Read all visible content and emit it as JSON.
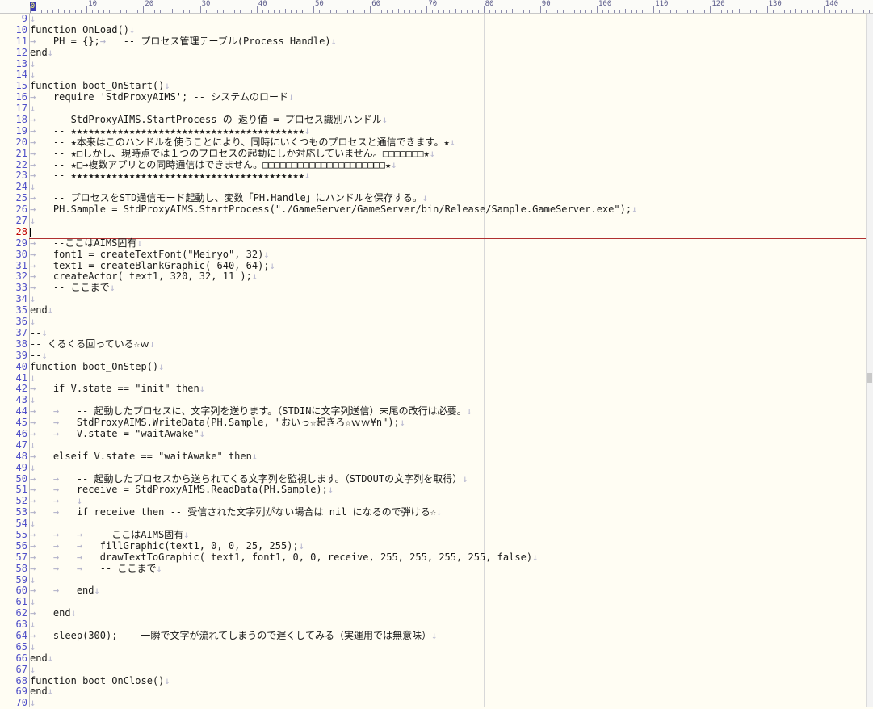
{
  "ruler": {
    "labels": [
      "10",
      "20",
      "30",
      "40",
      "50",
      "60",
      "70",
      "80",
      "90",
      "100",
      "110",
      "120",
      "130",
      "140"
    ],
    "cursor_label": "0"
  },
  "editor": {
    "lines": [
      {
        "n": "9",
        "t": ""
      },
      {
        "n": "10",
        "t": "function OnLoad()"
      },
      {
        "n": "11",
        "t": "\tPH = {};\t-- プロセス管理テーブル(Process Handle)"
      },
      {
        "n": "12",
        "t": "end"
      },
      {
        "n": "13",
        "t": ""
      },
      {
        "n": "14",
        "t": ""
      },
      {
        "n": "15",
        "t": "function boot_OnStart()"
      },
      {
        "n": "16",
        "t": "\trequire 'StdProxyAIMS'; -- システムのロード"
      },
      {
        "n": "17",
        "t": ""
      },
      {
        "n": "18",
        "t": "\t-- StdProxyAIMS.StartProcess の 返り値 = プロセス識別ハンドル"
      },
      {
        "n": "19",
        "t": "\t-- ★★★★★★★★★★★★★★★★★★★★★★★★★★★★★★★★★★★★★★★★"
      },
      {
        "n": "20",
        "t": "\t-- ★本来はこのハンドルを使うことにより、同時にいくつものプロセスと通信できます。★"
      },
      {
        "n": "21",
        "t": "\t-- ★□しかし、現時点では１つのプロセスの起動にしか対応していません。□□□□□□□★"
      },
      {
        "n": "22",
        "t": "\t-- ★□→複数アプリとの同時通信はできません。□□□□□□□□□□□□□□□□□□□□□★"
      },
      {
        "n": "23",
        "t": "\t-- ★★★★★★★★★★★★★★★★★★★★★★★★★★★★★★★★★★★★★★★★"
      },
      {
        "n": "24",
        "t": ""
      },
      {
        "n": "25",
        "t": "\t-- プロセスをSTD通信モード起動し、変数「PH.Handle」にハンドルを保存する。"
      },
      {
        "n": "26",
        "t": "\tPH.Sample = StdProxyAIMS.StartProcess(\"./GameServer/GameServer/bin/Release/Sample.GameServer.exe\");"
      },
      {
        "n": "27",
        "t": ""
      },
      {
        "n": "28",
        "t": ""
      },
      {
        "n": "29",
        "t": "\t--ここはAIMS固有"
      },
      {
        "n": "30",
        "t": "\tfont1 = createTextFont(\"Meiryo\", 32)"
      },
      {
        "n": "31",
        "t": "\ttext1 = createBlankGraphic( 640, 64);"
      },
      {
        "n": "32",
        "t": "\tcreateActor( text1, 320, 32, 11 );"
      },
      {
        "n": "33",
        "t": "\t-- ここまで"
      },
      {
        "n": "34",
        "t": ""
      },
      {
        "n": "35",
        "t": "end"
      },
      {
        "n": "36",
        "t": ""
      },
      {
        "n": "37",
        "t": "--"
      },
      {
        "n": "38",
        "t": "-- くるくる回っている☆ｗ"
      },
      {
        "n": "39",
        "t": "--"
      },
      {
        "n": "40",
        "t": "function boot_OnStep()"
      },
      {
        "n": "41",
        "t": ""
      },
      {
        "n": "42",
        "t": "\tif V.state == \"init\" then"
      },
      {
        "n": "43",
        "t": ""
      },
      {
        "n": "44",
        "t": "\t\t-- 起動したプロセスに、文字列を送ります。（STDINに文字列送信）末尾の改行は必要。"
      },
      {
        "n": "45",
        "t": "\t\tStdProxyAIMS.WriteData(PH.Sample, \"おいっ☆起きろ☆ｗｗ¥n\");"
      },
      {
        "n": "46",
        "t": "\t\tV.state = \"waitAwake\""
      },
      {
        "n": "47",
        "t": ""
      },
      {
        "n": "48",
        "t": "\telseif V.state == \"waitAwake\" then"
      },
      {
        "n": "49",
        "t": ""
      },
      {
        "n": "50",
        "t": "\t\t-- 起動したプロセスから送られてくる文字列を監視します。（STDOUTの文字列を取得）"
      },
      {
        "n": "51",
        "t": "\t\treceive = StdProxyAIMS.ReadData(PH.Sample);"
      },
      {
        "n": "52",
        "t": "\t\t"
      },
      {
        "n": "53",
        "t": "\t\tif receive then -- 受信された文字列がない場合は nil になるので弾ける☆"
      },
      {
        "n": "54",
        "t": ""
      },
      {
        "n": "55",
        "t": "\t\t\t--ここはAIMS固有"
      },
      {
        "n": "56",
        "t": "\t\t\tfillGraphic(text1, 0, 0, 25, 255);"
      },
      {
        "n": "57",
        "t": "\t\t\tdrawTextToGraphic( text1, font1, 0, 0, receive, 255, 255, 255, 255, false)"
      },
      {
        "n": "58",
        "t": "\t\t\t-- ここまで"
      },
      {
        "n": "59",
        "t": ""
      },
      {
        "n": "60",
        "t": "\t\tend"
      },
      {
        "n": "61",
        "t": ""
      },
      {
        "n": "62",
        "t": "\tend"
      },
      {
        "n": "63",
        "t": ""
      },
      {
        "n": "64",
        "t": "\tsleep(300); -- 一瞬で文字が流れてしまうので遅くしてみる（実運用では無意味）"
      },
      {
        "n": "65",
        "t": ""
      },
      {
        "n": "66",
        "t": "end"
      },
      {
        "n": "67",
        "t": ""
      },
      {
        "n": "68",
        "t": "function boot_OnClose()"
      },
      {
        "n": "69",
        "t": "end"
      },
      {
        "n": "70",
        "t": ""
      }
    ],
    "current_line": "28",
    "glyphs": {
      "tab": "→",
      "eol": "↓"
    },
    "colors": {
      "line_number": "#4f4fc8",
      "current_line": "#c00000",
      "background": "#fffdf3"
    }
  }
}
